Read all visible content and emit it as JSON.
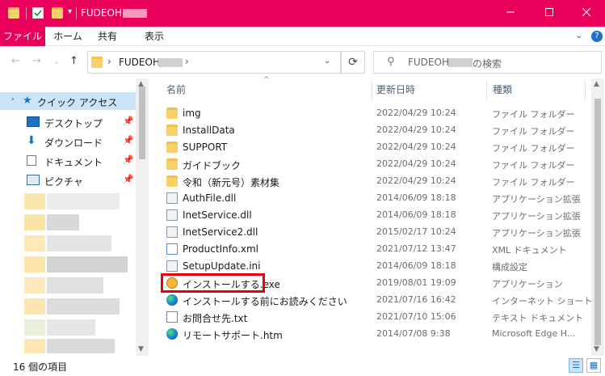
{
  "window": {
    "title": "FUDEOH"
  },
  "ribbon": {
    "tabs": [
      {
        "label": "ファイル",
        "active": true
      },
      {
        "label": "ホーム",
        "active": false
      },
      {
        "label": "共有",
        "active": false
      },
      {
        "label": "表示",
        "active": false
      }
    ],
    "expand": "⌄",
    "help": "?"
  },
  "address": {
    "crumb": "FUDEOH"
  },
  "search": {
    "prefix": "FUDEOH",
    "suffix": "の検索"
  },
  "navpane": {
    "quick_access": "クイック アクセス",
    "items": [
      {
        "label": "デスクトップ",
        "icon": "desktop-icon"
      },
      {
        "label": "ダウンロード",
        "icon": "download-icon"
      },
      {
        "label": "ドキュメント",
        "icon": "document-icon"
      },
      {
        "label": "ピクチャ",
        "icon": "pictures-icon"
      }
    ]
  },
  "columns": {
    "name": "名前",
    "modified": "更新日時",
    "type": "種類"
  },
  "files": [
    {
      "name": "img",
      "date": "2022/04/29 10:24",
      "type": "ファイル フォルダー",
      "icon": "folder-icon"
    },
    {
      "name": "InstallData",
      "date": "2022/04/29 10:24",
      "type": "ファイル フォルダー",
      "icon": "folder-icon"
    },
    {
      "name": "SUPPORT",
      "date": "2022/04/29 10:24",
      "type": "ファイル フォルダー",
      "icon": "folder-icon"
    },
    {
      "name": "ガイドブック",
      "date": "2022/04/29 10:24",
      "type": "ファイル フォルダー",
      "icon": "folder-icon"
    },
    {
      "name": "令和（新元号）素材集",
      "date": "2022/04/29 10:24",
      "type": "ファイル フォルダー",
      "icon": "folder-icon"
    },
    {
      "name": "AuthFile.dll",
      "date": "2014/06/09 18:18",
      "type": "アプリケーション拡張",
      "icon": "dll-file-icon"
    },
    {
      "name": "InetService.dll",
      "date": "2014/06/09 18:18",
      "type": "アプリケーション拡張",
      "icon": "dll-file-icon"
    },
    {
      "name": "InetService2.dll",
      "date": "2015/02/17 10:24",
      "type": "アプリケーション拡張",
      "icon": "dll-file-icon"
    },
    {
      "name": "ProductInfo.xml",
      "date": "2021/07/12 13:47",
      "type": "XML ドキュメント",
      "icon": "xml-file-icon"
    },
    {
      "name": "SetupUpdate.ini",
      "date": "2014/06/09 18:18",
      "type": "構成設定",
      "icon": "ini-file-icon"
    },
    {
      "name": "インストールする.exe",
      "date": "2019/08/01 19:09",
      "type": "アプリケーション",
      "icon": "installer-icon"
    },
    {
      "name": "インストールする前にお読みください",
      "date": "2021/07/16 16:42",
      "type": "インターネット ショート...",
      "icon": "edge-shortcut-icon"
    },
    {
      "name": "お問合せ先.txt",
      "date": "2021/07/10 15:06",
      "type": "テキスト ドキュメント",
      "icon": "text-file-icon"
    },
    {
      "name": "リモートサポート.htm",
      "date": "2014/07/08 9:38",
      "type": "Microsoft Edge H...",
      "icon": "edge-icon"
    }
  ],
  "status": {
    "count": "16 個の項目"
  },
  "colors": {
    "accent": "#e8005a",
    "highlight": "#e8000f",
    "selection": "#cce4f7"
  }
}
